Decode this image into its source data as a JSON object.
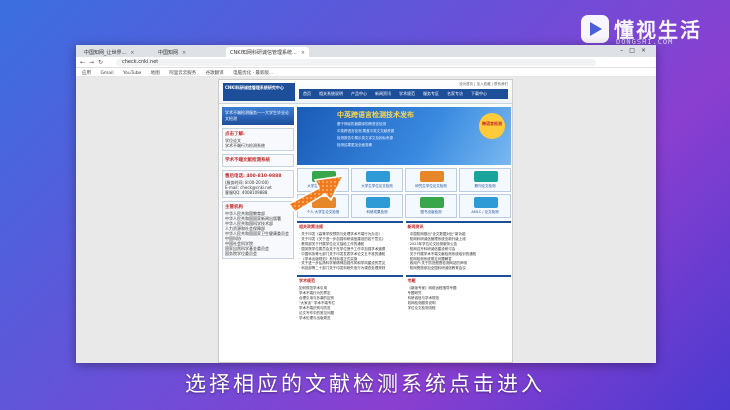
{
  "watermark": {
    "title": "懂视生活",
    "subtitle": "DONGSHI.COM",
    "accent": "#ffffff"
  },
  "browser": {
    "tabs": [
      {
        "label": "中国知网_让世界..."
      },
      {
        "label": "中国知网"
      },
      {
        "label": "CNKI知网科研诚信管理系统..."
      }
    ],
    "url": "check.cnki.net",
    "bookmarks": [
      "应用",
      "Gmail",
      "YouTube",
      "地图",
      "阿里云云服务",
      "谷歌翻译",
      "电脑优化 · 最新版..."
    ]
  },
  "site": {
    "logo": "CNKI科研诚信管理系统研究中心",
    "top_links": "设为首页 | 加入收藏 | 联系我们",
    "menu": [
      "首页",
      "相关系统说明",
      "产品中心",
      "新闻资讯",
      "学术规范",
      "服务专区",
      "名家专访",
      "下载中心"
    ],
    "left": {
      "banner": "学术不端检测服务——大学生毕业论文检测",
      "box1_title": "点击了解:",
      "box1_lines": [
        "学位论文",
        "学术不端行为检测系统"
      ],
      "box2_title": "学术不端文献检测系统",
      "contact_title": "售后电话: 400-810-9888",
      "contact_lines": [
        "(服务时间: 8:00-20:00)",
        "E-mail: check@cnki.net",
        "客服QQ: 4008109888"
      ],
      "orgs_title": "主管机构",
      "orgs": [
        "中华人民共和国教育部",
        "中华人民共和国国家新闻出版署",
        "中华人民共和国科学技术部",
        "人力资源和社会保障部",
        "中华人民共和国国家卫生健康委员会",
        "中国科协",
        "中国社会科学院",
        "国家自然科学基金委员会",
        "国务院学位委员会"
      ]
    },
    "hero": {
      "title": "中英跨语言检测技术发布",
      "lines": [
        "基于神经机器翻译的跨语言检测",
        "中英跨语言检测,覆盖中英文文献资源",
        "检测报告中展示英文译文及相似来源",
        "检测结果更加全面准确"
      ],
      "badge": "跨语言检测"
    },
    "cells": [
      {
        "label": "大学生论文检测服务"
      },
      {
        "label": "大学生学位论文检测"
      },
      {
        "label": "研究生学位论文检测"
      },
      {
        "label": "期刊论文检测"
      },
      {
        "label": "个人·大学生论文检测"
      },
      {
        "label": "科研成果检测"
      },
      {
        "label": "图书出版检测"
      },
      {
        "label": "AMLC / 论文检测"
      }
    ],
    "sections": {
      "policy_title": "相关政策法规",
      "policy_more": "更多>>",
      "policy_items": [
        "· 关于印发《高等学校预防与处理学术不端行为办法》",
        "· 关于印发《关于进一步加强科研诚信建设的若干意见》",
        "· 教育部关于开展学位论文抽检工作的通知",
        "· 国务院学位委员会关于在学位授予工作中加强学术道德",
        "· 中国科协等七部门关于印发发表学术论文五不准的通知",
        "· 《学术出版规范》系列标准正式实施",
        "· 关于进一步弘扬科学家精神加强作风和学风建设的意见",
        "· 科技部等二十部门关于印发科研失信行为调查处理规则"
      ],
      "news_title": "新闻资讯",
      "news_more": "更多>>",
      "news_items": [
        "· 中国知网推出\"全文数据对比\"新功能",
        "· 知网科研诚信管理系统全新升级上线",
        "· 2023年学位论文检测服务公告",
        "· 知网召开科研诚信建设研讨会",
        "· 关于开展学术不端文献检测系统培训的通知",
        "· 知网检测系统常见问题解答",
        "· 致用户:关于防范假冒检测网站的声明",
        "· 知网受邀参加全国科研诚信教育会议"
      ],
      "academic_title": "学术规范",
      "academic_lines": [
        "如何规范学术引用",
        "学术不端行为的界定",
        "合理引用与抄袭的区别",
        "\"大家谈\" 学术不端专栏",
        "学术不端识别与防范",
        "论文写作中的常见问题",
        "学术伦理与出版规范"
      ],
      "special_title": "专题",
      "special_lines": [
        "《新版专家》网络远程指导专题",
        "专题研究",
        "科研诚信与学术规范",
        "知网检测服务说明",
        "学位论文检测流程"
      ]
    }
  },
  "caption": "选择相应的文献检测系统点击进入"
}
